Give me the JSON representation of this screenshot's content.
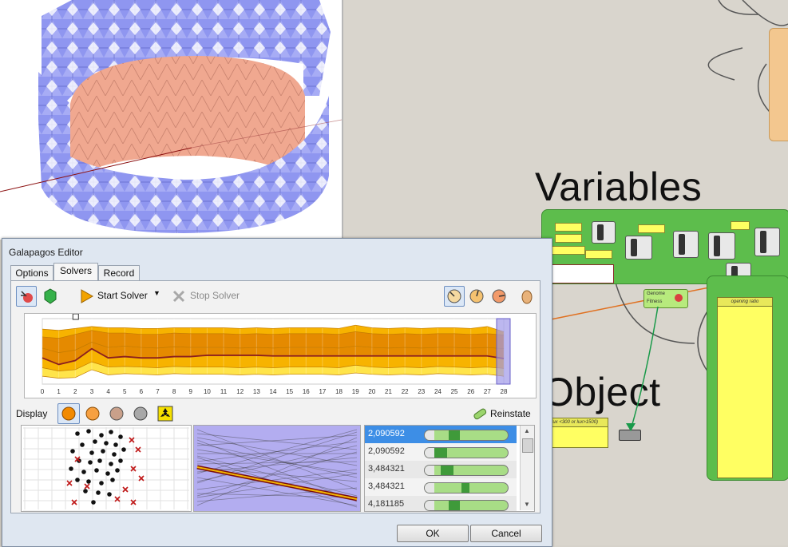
{
  "window": {
    "title": "Galapagos Editor"
  },
  "tabs": [
    {
      "label": "Options",
      "active": false
    },
    {
      "label": "Solvers",
      "active": true
    },
    {
      "label": "Record",
      "active": false
    }
  ],
  "toolbar": {
    "start_solver": "Start Solver",
    "stop_solver": "Stop Solver"
  },
  "chart_data": {
    "type": "area",
    "categories": [
      "0",
      "1",
      "2",
      "3",
      "4",
      "5",
      "6",
      "7",
      "8",
      "9",
      "10",
      "11",
      "12",
      "13",
      "14",
      "15",
      "16",
      "17",
      "18",
      "19",
      "20",
      "21",
      "22",
      "23",
      "24",
      "25",
      "26",
      "27",
      "28"
    ],
    "series": [
      {
        "values": [
          12,
          9,
          10,
          22,
          14,
          16,
          15,
          14,
          16,
          15,
          15,
          15,
          14,
          15,
          14,
          15,
          15,
          15,
          14,
          17,
          15,
          14,
          15,
          14,
          16,
          15,
          14,
          15,
          12
        ]
      },
      {
        "values": [
          25,
          20,
          22,
          34,
          26,
          27,
          26,
          25,
          27,
          26,
          26,
          26,
          25,
          26,
          25,
          26,
          26,
          26,
          25,
          29,
          26,
          25,
          26,
          25,
          27,
          26,
          25,
          26,
          24
        ]
      },
      {
        "values": [
          40,
          30,
          36,
          54,
          40,
          42,
          40,
          40,
          42,
          42,
          44,
          44,
          44,
          44,
          43,
          43,
          43,
          43,
          43,
          43,
          43,
          43,
          43,
          43,
          43,
          43,
          43,
          43,
          39
        ]
      },
      {
        "values": [
          55,
          48,
          52,
          64,
          56,
          58,
          56,
          55,
          57,
          56,
          56,
          56,
          55,
          56,
          55,
          56,
          56,
          56,
          55,
          58,
          56,
          55,
          56,
          55,
          56,
          56,
          55,
          56,
          54
        ]
      },
      {
        "values": [
          72,
          70,
          76,
          82,
          78,
          78,
          76,
          76,
          78,
          77,
          77,
          77,
          76,
          77,
          76,
          77,
          77,
          77,
          76,
          80,
          77,
          76,
          77,
          76,
          77,
          77,
          76,
          77,
          75
        ]
      },
      {
        "values": [
          84,
          82,
          85,
          88,
          86,
          86,
          85,
          85,
          86,
          86,
          86,
          86,
          85,
          86,
          85,
          86,
          86,
          86,
          85,
          90,
          86,
          85,
          86,
          85,
          86,
          86,
          85,
          88,
          80
        ]
      }
    ],
    "ylim": [
      0,
      100
    ],
    "grid": true
  },
  "display": {
    "label": "Display",
    "reinstate": "Reinstate"
  },
  "genomes": [
    {
      "value": "2,090592",
      "selected": true
    },
    {
      "value": "2,090592",
      "selected": false
    },
    {
      "value": "3,484321",
      "selected": false
    },
    {
      "value": "3,484321",
      "selected": false
    },
    {
      "value": "4,181185",
      "selected": false
    }
  ],
  "buttons": {
    "ok": "OK",
    "cancel": "Cancel"
  },
  "canvas": {
    "variables_label": "Variables",
    "object_label": "Object",
    "genome_label": "Genome",
    "fitness_label": "Fitness",
    "opening_ratio_label": "opening ratio",
    "condition_text": "lux <300 or lux>1500)"
  },
  "colors": {
    "mesh": "#8f96f0",
    "mesh_inner": "#f0a890",
    "chart_light": "#ffe44a",
    "chart_mid": "#f7b300",
    "chart_dark": "#e58a00",
    "chart_line": "#8b1f1f",
    "group_green": "#5dbd4c",
    "group_orange": "#f3c78f",
    "node_yellow": "#ffff62",
    "accent_blue": "#3d8ee6"
  }
}
